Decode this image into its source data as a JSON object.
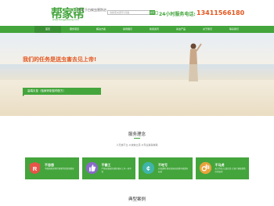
{
  "header": {
    "logo_text": "帮家帮",
    "logo_url": "www.bangjiabang.com",
    "slogan": "专注于白蚁虫害防治",
    "search_placeholder": "请搜索关键字/词语",
    "search_button": "搜索",
    "hotline_label": "24小时服务电话:",
    "hotline_number": "13411566180",
    "accent_color": "#43a53c",
    "hot_color": "#e4561e"
  },
  "nav": {
    "items": [
      {
        "label": "首页"
      },
      {
        "label": "服务项目"
      },
      {
        "label": "解决方案"
      },
      {
        "label": "案例展示"
      },
      {
        "label": "新闻资讯"
      },
      {
        "label": "杀虫产品"
      },
      {
        "label": "关于我们"
      },
      {
        "label": "联系我们"
      }
    ]
  },
  "banner": {
    "title": "我们的任务是送虫害去见上帝!",
    "tag": "高端灭鼠（独家研制鼠药配方）"
  },
  "service_concept": {
    "title": "服务理念",
    "subtitle": "人无信不立,以诚信立足,以专业赢得信赖",
    "cards": [
      {
        "icon": "r-letter-icon",
        "title": "不忽悠",
        "desc": "不面色暗沉地行销事件忽悠消费者"
      },
      {
        "icon": "thumbs-up-icon",
        "title": "不偷工",
        "desc": "严格标准服务流程,细节工序一丝不苟"
      },
      {
        "icon": "money-icon",
        "title": "不吃亏",
        "desc": "价格透明,提前告知价格所有收费有标准"
      },
      {
        "icon": "ok-hand-icon",
        "title": "不马虎",
        "desc": "无尘作业,认真负责,让客户满意是我们的追求"
      }
    ]
  },
  "cases": {
    "title": "典型案例"
  }
}
